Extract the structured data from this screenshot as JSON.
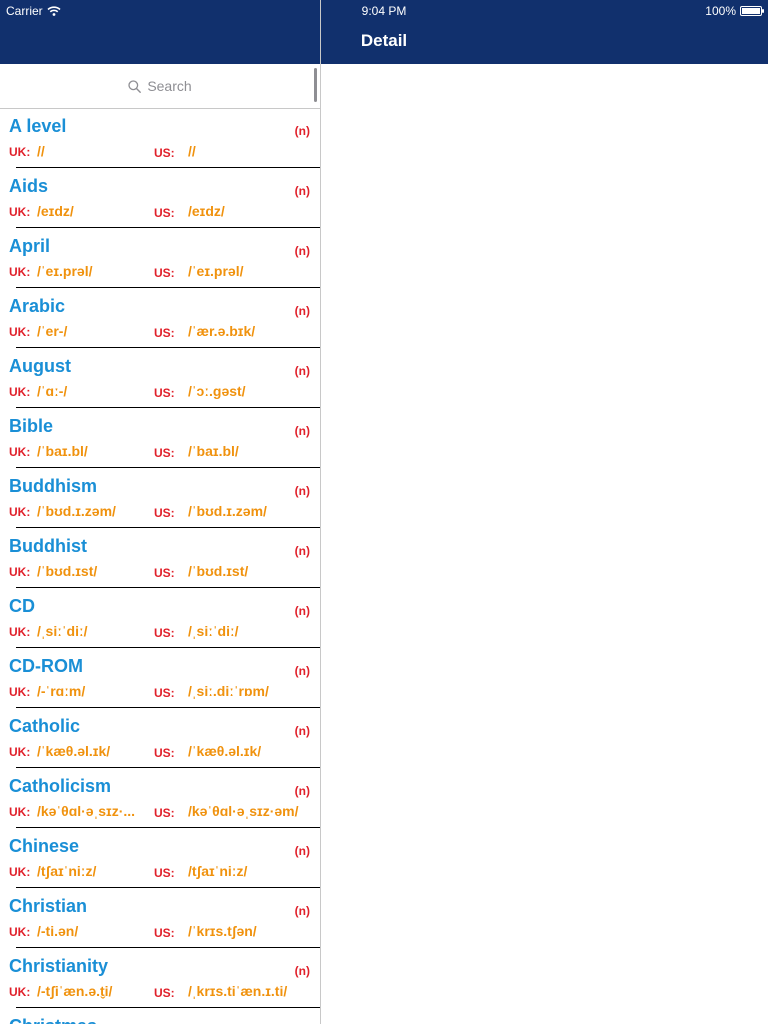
{
  "status_bar": {
    "carrier": "Carrier",
    "time": "9:04 PM",
    "battery": "100%"
  },
  "detail": {
    "title": "Detail"
  },
  "search": {
    "placeholder": "Search"
  },
  "labels": {
    "uk": "UK:",
    "us": "US:"
  },
  "colors": {
    "nav_bar": "#11306d",
    "word": "#1a8fd6",
    "label": "#e0202a",
    "pronunciation": "#f0920e"
  },
  "entries": [
    {
      "word": "A level",
      "pos": "(n)",
      "uk": "//",
      "us": "//"
    },
    {
      "word": "Aids",
      "pos": "(n)",
      "uk": "/eɪdz/",
      "us": "/eɪdz/"
    },
    {
      "word": "April",
      "pos": "(n)",
      "uk": "/ˈeɪ.prəl/",
      "us": "/ˈeɪ.prəl/"
    },
    {
      "word": "Arabic",
      "pos": "(n)",
      "uk": "/ˈer-/",
      "us": "/ˈær.ə.bɪk/"
    },
    {
      "word": "August",
      "pos": "(n)",
      "uk": "/ˈɑː-/",
      "us": "/ˈɔː.gəst/"
    },
    {
      "word": "Bible",
      "pos": "(n)",
      "uk": "/ˈbaɪ.bl/",
      "us": "/ˈbaɪ.bl/"
    },
    {
      "word": "Buddhism",
      "pos": "(n)",
      "uk": "/ˈbʊd.ɪ.zəm/",
      "us": "/ˈbʊd.ɪ.zəm/"
    },
    {
      "word": "Buddhist",
      "pos": "(n)",
      "uk": "/ˈbʊd.ɪst/",
      "us": "/ˈbʊd.ɪst/"
    },
    {
      "word": "CD",
      "pos": "(n)",
      "uk": "/ˌsiːˈdiː/",
      "us": "/ˌsiːˈdiː/"
    },
    {
      "word": "CD-ROM",
      "pos": "(n)",
      "uk": "/-ˈrɑːm/",
      "us": "/ˌsiː.diːˈrɒm/"
    },
    {
      "word": "Catholic",
      "pos": "(n)",
      "uk": "/ˈkæθ.əl.ɪk/",
      "us": "/ˈkæθ.əl.ɪk/"
    },
    {
      "word": "Catholicism",
      "pos": "(n)",
      "uk": "/kəˈθɑl·əˌsɪz·...",
      "us": "/kəˈθɑl·əˌsɪz·əm/"
    },
    {
      "word": "Chinese",
      "pos": "(n)",
      "uk": "/tʃaɪˈniːz/",
      "us": "/tʃaɪˈniːz/"
    },
    {
      "word": "Christian",
      "pos": "(n)",
      "uk": "/-ti.ən/",
      "us": "/ˈkrɪs.tʃən/"
    },
    {
      "word": "Christianity",
      "pos": "(n)",
      "uk": "/-tʃiˈæn.ə.t̬i/",
      "us": "/ˌkrɪs.tiˈæn.ɪ.ti/"
    },
    {
      "word": "Christmas",
      "pos": "(n)",
      "uk": "",
      "us": ""
    }
  ]
}
